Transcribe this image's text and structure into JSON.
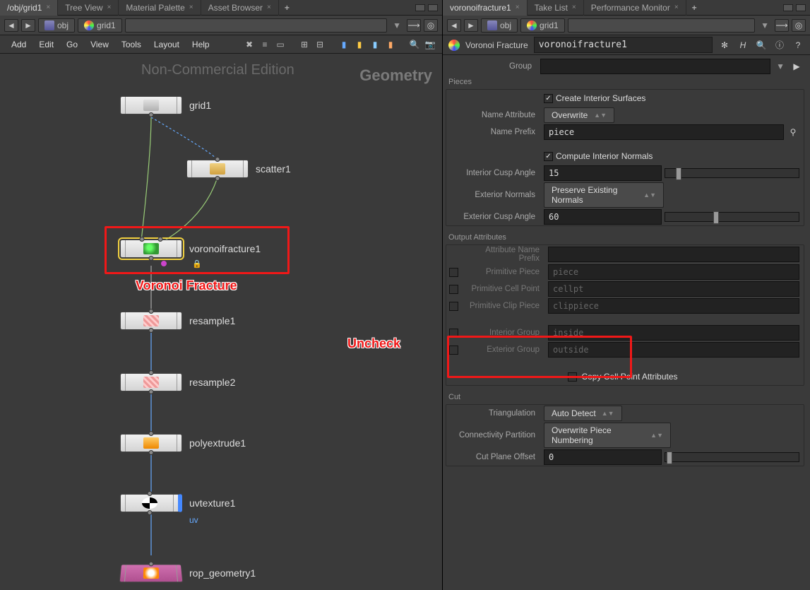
{
  "leftPane": {
    "tabs": [
      {
        "label": "/obj/grid1",
        "active": true
      },
      {
        "label": "Tree View",
        "active": false
      },
      {
        "label": "Material Palette",
        "active": false
      },
      {
        "label": "Asset Browser",
        "active": false
      }
    ],
    "path": {
      "seg1": "obj",
      "seg2": "grid1"
    },
    "menu": [
      "Add",
      "Edit",
      "Go",
      "View",
      "Tools",
      "Layout",
      "Help"
    ],
    "watermark": "Non-Commercial Edition",
    "context": "Geometry",
    "nodes": {
      "grid": "grid1",
      "scatter": "scatter1",
      "voronoi": "voronoifracture1",
      "resample1": "resample1",
      "resample2": "resample2",
      "polyextrude": "polyextrude1",
      "uvtexture": "uvtexture1",
      "uvtag": "uv",
      "rop": "rop_geometry1"
    },
    "annot": {
      "voronoi": "Voronoi Fracture",
      "uncheck": "Uncheck"
    }
  },
  "rightPane": {
    "tabs": [
      {
        "label": "voronoifracture1",
        "active": true
      },
      {
        "label": "Take List",
        "active": false
      },
      {
        "label": "Performance Monitor",
        "active": false
      }
    ],
    "path": {
      "seg1": "obj",
      "seg2": "grid1"
    },
    "header": {
      "type": "Voronoi Fracture",
      "name": "voronoifracture1"
    },
    "groupLabel": "Group",
    "sections": {
      "pieces": "Pieces",
      "output": "Output Attributes",
      "cut": "Cut"
    },
    "params": {
      "createInterior": {
        "label": "Create Interior Surfaces",
        "checked": true
      },
      "nameAttr": {
        "label": "Name Attribute",
        "value": "Overwrite"
      },
      "namePrefix": {
        "label": "Name Prefix",
        "value": "piece"
      },
      "computeNormals": {
        "label": "Compute Interior Normals",
        "checked": true
      },
      "interiorCusp": {
        "label": "Interior Cusp Angle",
        "value": "15",
        "pct": 8
      },
      "exteriorNormals": {
        "label": "Exterior Normals",
        "value": "Preserve Existing Normals"
      },
      "exteriorCusp": {
        "label": "Exterior Cusp Angle",
        "value": "60",
        "pct": 36
      },
      "attrPrefix": {
        "label": "Attribute Name Prefix",
        "value": ""
      },
      "primPiece": {
        "label": "Primitive Piece",
        "value": "piece",
        "checked": false
      },
      "primCell": {
        "label": "Primitive Cell Point",
        "value": "cellpt",
        "checked": false
      },
      "primClip": {
        "label": "Primitive Clip Piece",
        "value": "clippiece",
        "checked": false
      },
      "interiorGroup": {
        "label": "Interior Group",
        "value": "inside",
        "checked": false
      },
      "exteriorGroup": {
        "label": "Exterior Group",
        "value": "outside",
        "checked": false
      },
      "copyCell": {
        "label": "Copy Cell Point Attributes",
        "checked": false
      },
      "triangulation": {
        "label": "Triangulation",
        "value": "Auto Detect"
      },
      "connectivity": {
        "label": "Connectivity Partition",
        "value": "Overwrite Piece Numbering"
      },
      "cutOffset": {
        "label": "Cut Plane Offset",
        "value": "0",
        "pct": 1
      }
    }
  }
}
